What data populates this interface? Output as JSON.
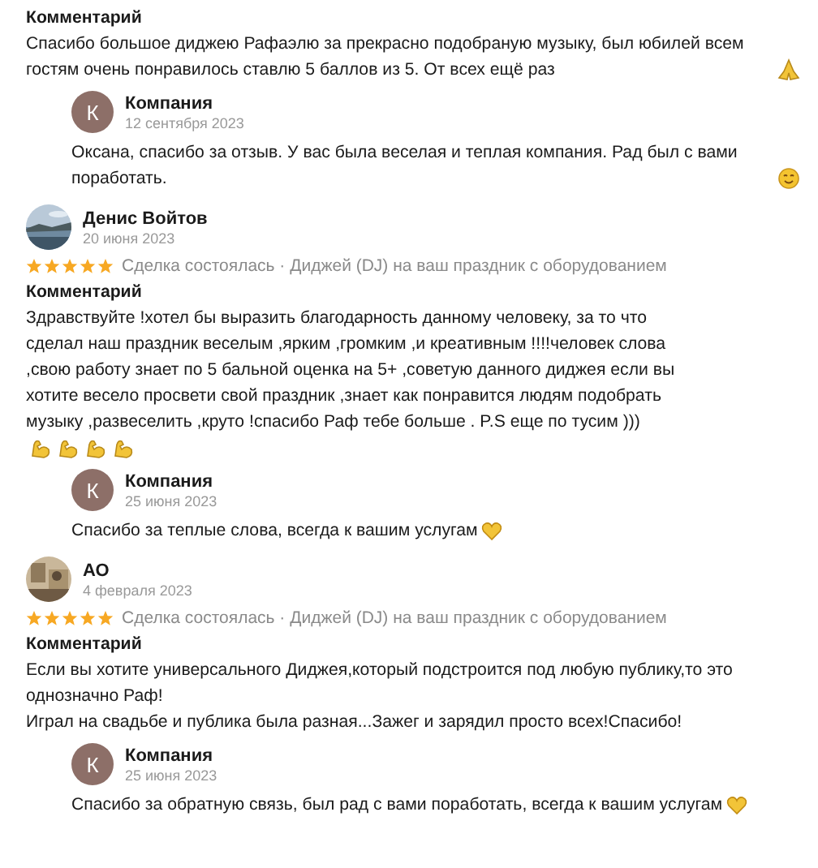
{
  "reviews": [
    {
      "comment_label": "Комментарий",
      "comment": [
        "Спасибо большое диджею Рафаэлю за прекрасно подобраную музыку, был юбилей всем гостям очень понравилось ставлю 5 баллов из 5. От всех ещё раз"
      ],
      "comment_icons": [
        {
          "kind": "pray"
        }
      ],
      "reply": {
        "name": "Компания",
        "avatar_letter": "К",
        "date": "12 сентября 2023",
        "text": "Оксана, спасибо за отзыв. У вас была веселая и теплая компания. Рад был с вами поработать.",
        "icons": [
          {
            "kind": "smile"
          }
        ]
      }
    },
    {
      "author": {
        "name": "Денис Войтов",
        "date": "20 июня 2023"
      },
      "stars": 5,
      "meta": "Сделка состоялась · Диджей (DJ) на ваш праздник с оборудованием",
      "comment_label": "Комментарий",
      "comment": [
        "Здравствуйте !хотел бы выразить благодарность данному человеку, за то что сделал наш праздник веселым ,ярким ,громким ,и креативным !!!!человек слова ,свою работу знает по 5 бальной оценка на 5+ ,советую данного диджея если вы хотите весело просвети свой праздник ,знает как понравится людям подобрать музыку ,развеселить ,круто !спасибо Раф тебе больше . P.S еще по тусим )))"
      ],
      "comment_icons": [
        {
          "kind": "muscle"
        },
        {
          "kind": "muscle"
        },
        {
          "kind": "muscle"
        },
        {
          "kind": "muscle"
        }
      ],
      "reply": {
        "name": "Компания",
        "avatar_letter": "К",
        "date": "25 июня 2023",
        "text": "Спасибо за теплые слова, всегда к вашим услугам",
        "icons": [
          {
            "kind": "heart"
          }
        ]
      }
    },
    {
      "author": {
        "name": "АО",
        "date": "4 февраля 2023"
      },
      "stars": 5,
      "meta": "Сделка состоялась · Диджей (DJ) на ваш праздник с оборудованием",
      "comment_label": "Комментарий",
      "comment": [
        "Если вы хотите универсального Диджея,который подстроится под любую публику,то это однозначно Раф!",
        "Играл на свадьбе и публика была разная...Зажег и зарядил просто всех!Спасибо!"
      ],
      "reply": {
        "name": "Компания",
        "avatar_letter": "К",
        "date": "25 июня 2023",
        "text": "Спасибо за обратную связь, был рад с вами поработать, всегда к вашим услугам",
        "icons": [
          {
            "kind": "heart"
          }
        ]
      }
    }
  ]
}
